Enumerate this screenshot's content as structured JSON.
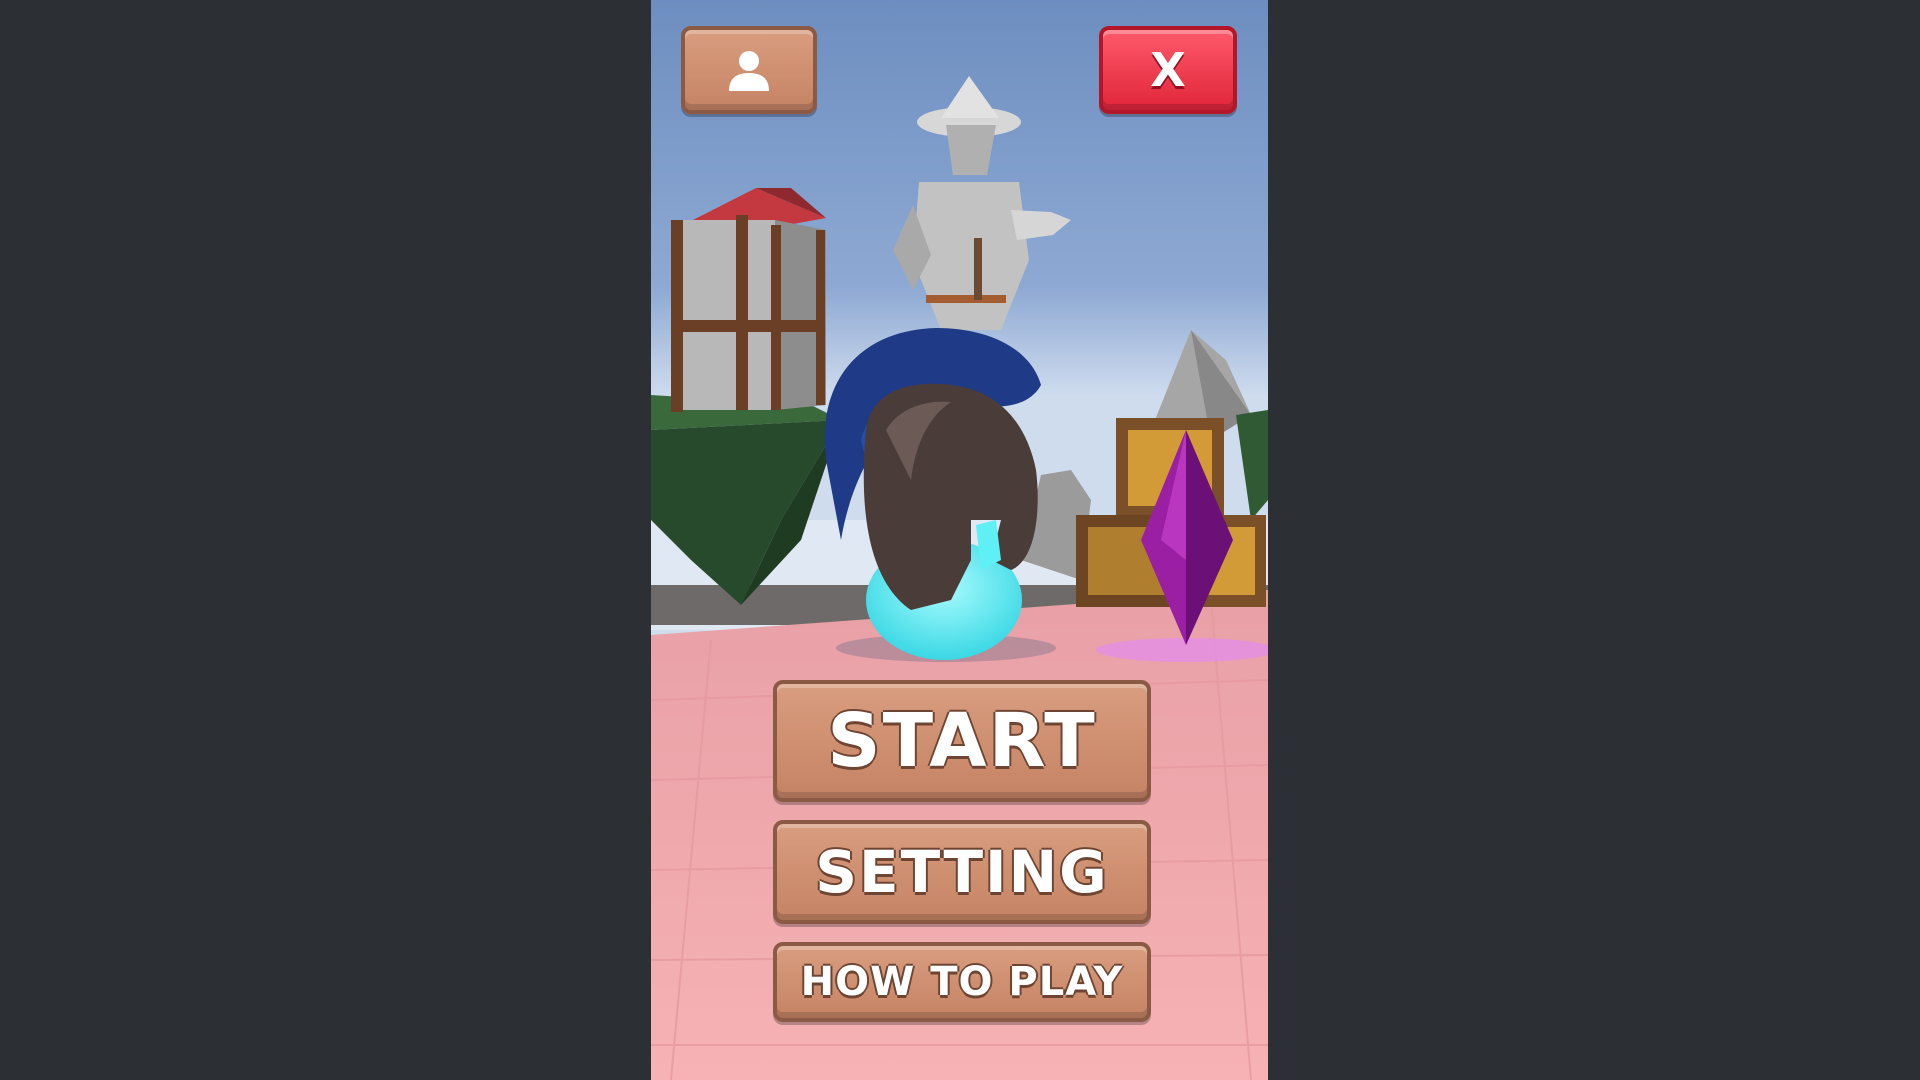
{
  "menu": {
    "close_label": "X",
    "start_label": "START",
    "setting_label": "SETTING",
    "how_to_play_label": "HOW TO PLAY"
  },
  "icons": {
    "profile": "user-icon"
  },
  "colors": {
    "letterbox": "#2c2f33",
    "sky_top": "#6d8ec0",
    "sky_bottom": "#a9c3e2",
    "floor": "#f2a7ab",
    "wood_button": "#d2927a",
    "close_button": "#f03a4c",
    "gem": "#a020a8",
    "ball": "#6ff3f8"
  }
}
